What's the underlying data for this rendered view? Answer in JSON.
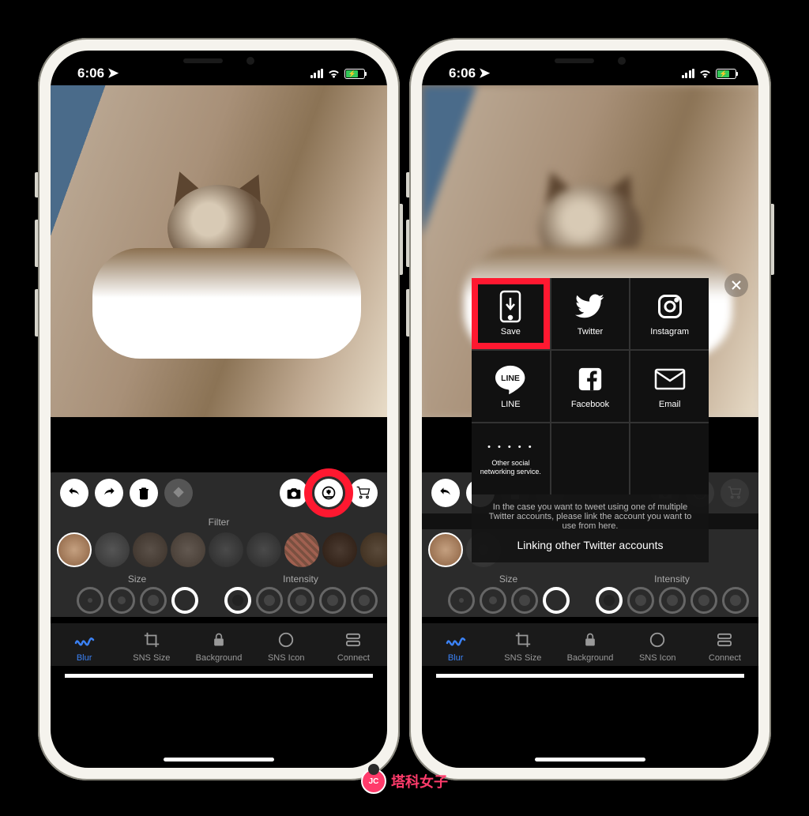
{
  "status": {
    "time": "6:06",
    "location_icon": "➤"
  },
  "action_buttons": {
    "undo": "undo-icon",
    "redo": "redo-icon",
    "trash": "trash-icon",
    "shape": "shape-icon",
    "camera": "camera-icon",
    "download": "download-icon",
    "cart": "cart-icon"
  },
  "filter_section": {
    "label": "Filter"
  },
  "size_section": {
    "label": "Size"
  },
  "intensity_section": {
    "label": "Intensity"
  },
  "tabs": [
    {
      "id": "blur",
      "label": "Blur",
      "active": true
    },
    {
      "id": "sns-size",
      "label": "SNS Size",
      "active": false
    },
    {
      "id": "background",
      "label": "Background",
      "active": false
    },
    {
      "id": "sns-icon",
      "label": "SNS Icon",
      "active": false
    },
    {
      "id": "connect",
      "label": "Connect",
      "active": false
    }
  ],
  "share": {
    "items": [
      {
        "id": "save",
        "label": "Save",
        "highlighted": true
      },
      {
        "id": "twitter",
        "label": "Twitter",
        "highlighted": false
      },
      {
        "id": "instagram",
        "label": "Instagram",
        "highlighted": false
      },
      {
        "id": "line",
        "label": "LINE",
        "highlighted": false
      },
      {
        "id": "facebook",
        "label": "Facebook",
        "highlighted": false
      },
      {
        "id": "email",
        "label": "Email",
        "highlighted": false
      }
    ],
    "other_label": "Other social networking service.",
    "hint": "In the case you want to tweet using one of multiple Twitter accounts, please link the account you want to use from here.",
    "link_label": "Linking other Twitter accounts"
  },
  "watermark": {
    "badge": "JC",
    "text": "塔科女子"
  },
  "colors": {
    "highlight": "#ff1830",
    "active_tab": "#3b82f6",
    "battery_fill": "#34c759"
  }
}
